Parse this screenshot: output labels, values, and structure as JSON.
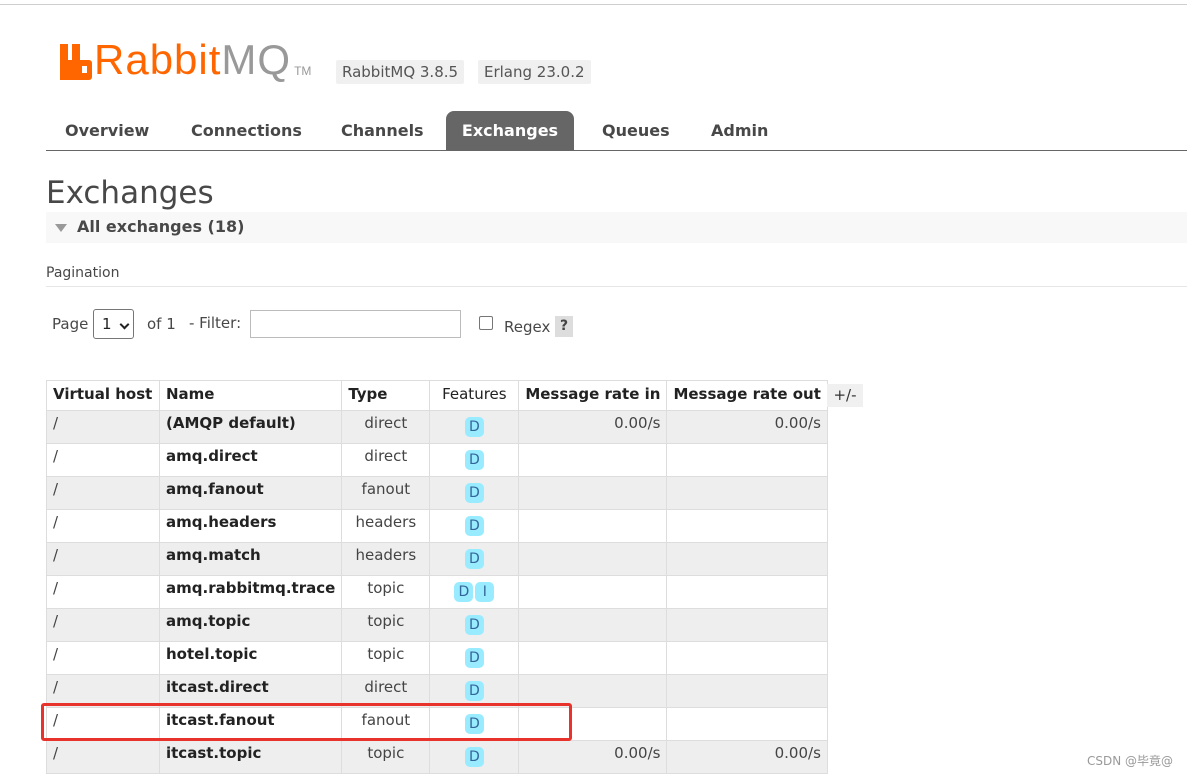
{
  "app": {
    "logo_text": "Rabbit",
    "logo_text_mq": "MQ",
    "logo_tm": "TM",
    "version": "RabbitMQ 3.8.5",
    "erlang": "Erlang 23.0.2"
  },
  "tabs": [
    {
      "label": "Overview"
    },
    {
      "label": "Connections"
    },
    {
      "label": "Channels"
    },
    {
      "label": "Exchanges",
      "active": true
    },
    {
      "label": "Queues"
    },
    {
      "label": "Admin"
    }
  ],
  "page_title": "Exchanges",
  "section_title": "All exchanges (18)",
  "pagination": {
    "label": "Pagination",
    "page_label": "Page",
    "page_value": "1",
    "of_label": "of 1",
    "filter_label": "- Filter:",
    "filter_value": "",
    "regex_label": "Regex",
    "help_label": "?"
  },
  "table": {
    "headers": {
      "vhost": "Virtual host",
      "name": "Name",
      "type": "Type",
      "features": "Features",
      "rate_in": "Message rate in",
      "rate_out": "Message rate out"
    },
    "toggle_label": "+/-",
    "rows": [
      {
        "vhost": "/",
        "name": "(AMQP default)",
        "type": "direct",
        "features": [
          "D"
        ],
        "rate_in": "0.00/s",
        "rate_out": "0.00/s"
      },
      {
        "vhost": "/",
        "name": "amq.direct",
        "type": "direct",
        "features": [
          "D"
        ],
        "rate_in": "",
        "rate_out": ""
      },
      {
        "vhost": "/",
        "name": "amq.fanout",
        "type": "fanout",
        "features": [
          "D"
        ],
        "rate_in": "",
        "rate_out": ""
      },
      {
        "vhost": "/",
        "name": "amq.headers",
        "type": "headers",
        "features": [
          "D"
        ],
        "rate_in": "",
        "rate_out": ""
      },
      {
        "vhost": "/",
        "name": "amq.match",
        "type": "headers",
        "features": [
          "D"
        ],
        "rate_in": "",
        "rate_out": ""
      },
      {
        "vhost": "/",
        "name": "amq.rabbitmq.trace",
        "type": "topic",
        "features": [
          "D",
          "I"
        ],
        "rate_in": "",
        "rate_out": ""
      },
      {
        "vhost": "/",
        "name": "amq.topic",
        "type": "topic",
        "features": [
          "D"
        ],
        "rate_in": "",
        "rate_out": ""
      },
      {
        "vhost": "/",
        "name": "hotel.topic",
        "type": "topic",
        "features": [
          "D"
        ],
        "rate_in": "",
        "rate_out": ""
      },
      {
        "vhost": "/",
        "name": "itcast.direct",
        "type": "direct",
        "features": [
          "D"
        ],
        "rate_in": "",
        "rate_out": ""
      },
      {
        "vhost": "/",
        "name": "itcast.fanout",
        "type": "fanout",
        "features": [
          "D"
        ],
        "rate_in": "",
        "rate_out": ""
      },
      {
        "vhost": "/",
        "name": "itcast.topic",
        "type": "topic",
        "features": [
          "D"
        ],
        "rate_in": "0.00/s",
        "rate_out": "0.00/s"
      }
    ]
  },
  "watermark": "CSDN @毕竟@",
  "colors": {
    "brand_orange": "#ff6600",
    "tab_active": "#666666",
    "badge_bg": "#99ebff",
    "highlight_red": "#e8322c"
  }
}
